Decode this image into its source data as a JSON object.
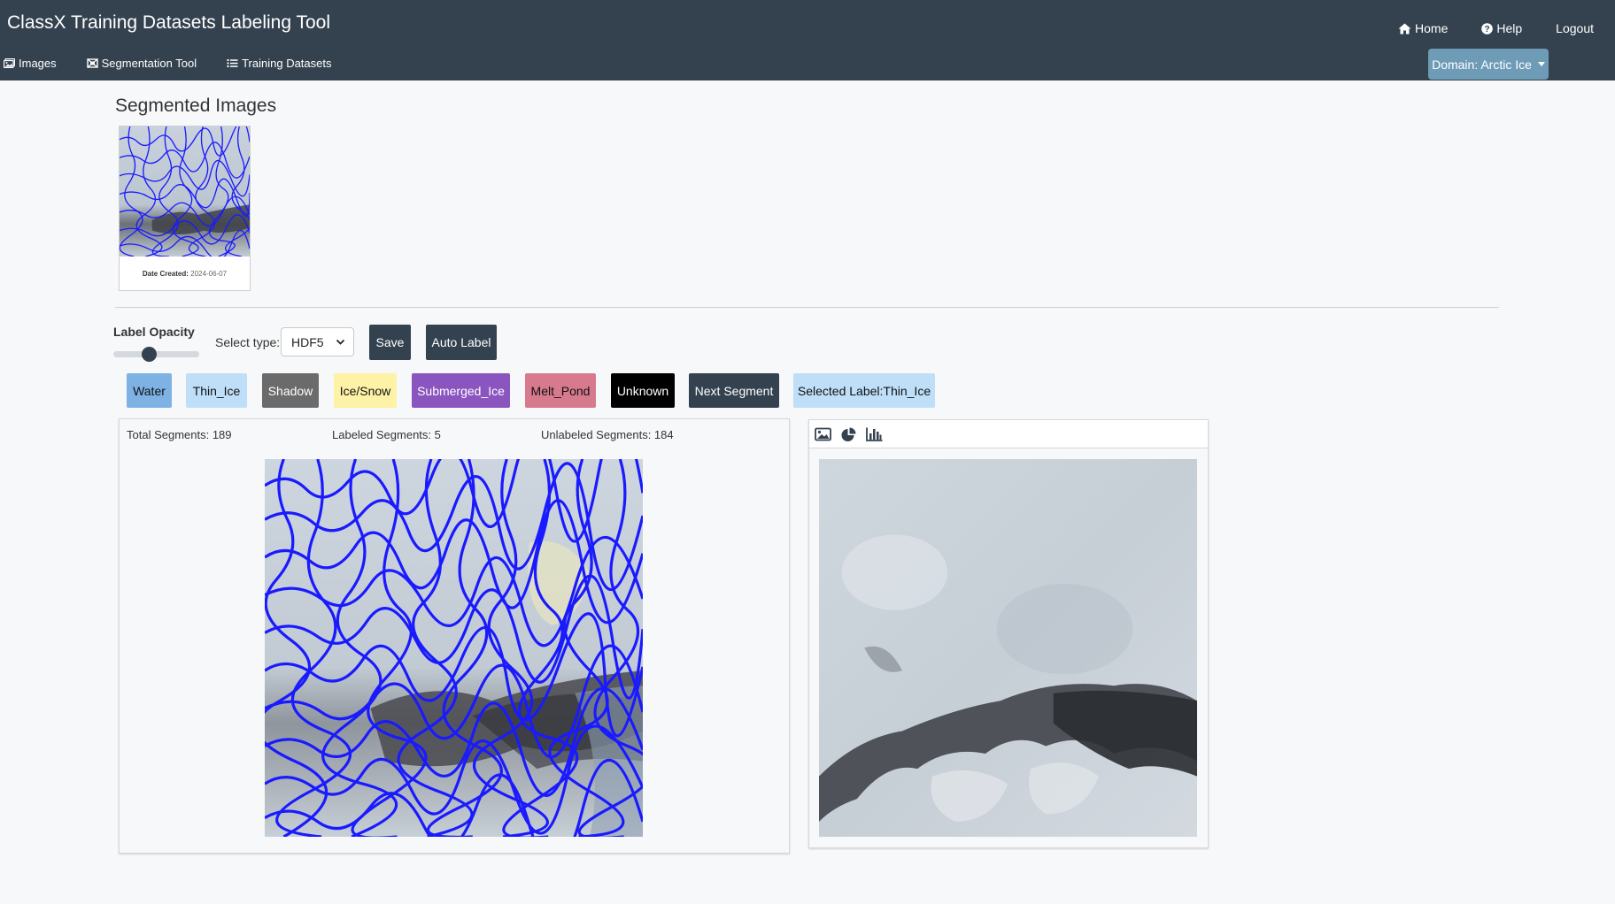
{
  "app": {
    "title": "ClassX Training Datasets Labeling Tool"
  },
  "nav": {
    "left": [
      {
        "label": "Images",
        "icon": "images-icon"
      },
      {
        "label": "Segmentation Tool",
        "icon": "segmentation-icon"
      },
      {
        "label": "Training Datasets",
        "icon": "list-icon"
      }
    ],
    "right": [
      {
        "label": "Home",
        "icon": "home-icon"
      },
      {
        "label": "Help",
        "icon": "help-icon"
      },
      {
        "label": "Logout"
      }
    ],
    "domain_dropdown": "Domain: Arctic Ice"
  },
  "segmented": {
    "title": "Segmented Images",
    "thumb": {
      "date_label": "Date Created:",
      "date_value": "2024-06-07"
    }
  },
  "controls": {
    "opacity_label": "Label Opacity",
    "opacity_value": 0.4,
    "select_label": "Select type:",
    "select_value": "HDF5",
    "save_label": "Save",
    "auto_label": "Auto Label"
  },
  "labels": [
    {
      "name": "Water",
      "color": "#7eb2e4"
    },
    {
      "name": "Thin_Ice",
      "color": "#bfdff8"
    },
    {
      "name": "Shadow",
      "color": "#6b6b6b"
    },
    {
      "name": "Ice/Snow",
      "color": "#fdf2a5"
    },
    {
      "name": "Submerged_Ice",
      "color": "#8b55c0"
    },
    {
      "name": "Melt_Pond",
      "color": "#d77a8e"
    },
    {
      "name": "Unknown",
      "color": "#000000"
    }
  ],
  "next_segment_label": "Next Segment",
  "selected_label_text": "Selected Label:Thin_Ice",
  "stats": {
    "total": "Total Segments: 189",
    "labeled": "Labeled Segments: 5",
    "unlabeled": "Unlabeled Segments: 184"
  },
  "colors": {
    "navbar": "#34424f",
    "domain_button": "#6e9bb6",
    "segment_outline": "#1a1aff",
    "selected_label_bg": "#bfdff8"
  },
  "right_toolbar_icons": [
    "image-icon",
    "pie-chart-icon",
    "bar-chart-icon"
  ]
}
